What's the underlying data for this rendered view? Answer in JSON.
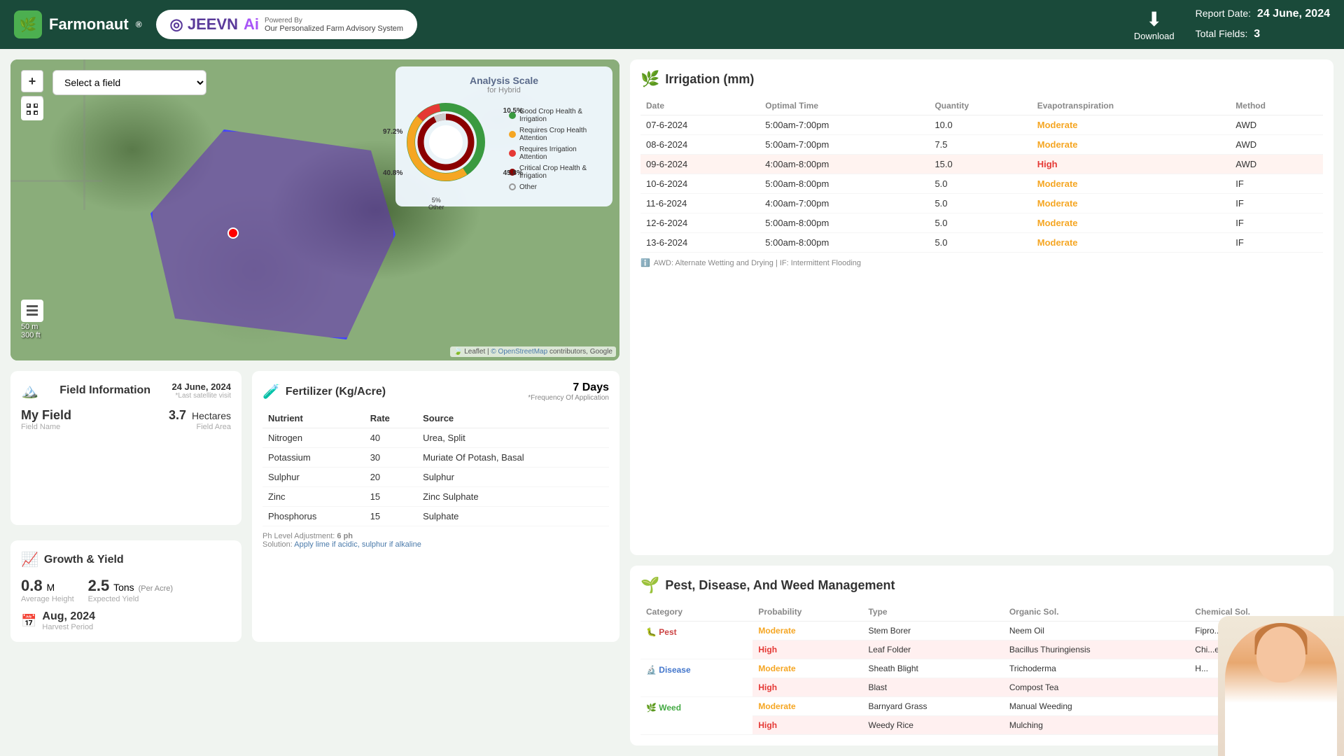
{
  "header": {
    "logo_text": "Farmonaut",
    "logo_reg": "®",
    "jeevn_label": "JEEVN",
    "ai_label": "Ai",
    "powered_by": "Powered By",
    "powered_sub": "Our Personalized Farm Advisory System",
    "report_date_label": "Report Date:",
    "report_date_value": "24 June, 2024",
    "total_fields_label": "Total Fields:",
    "total_fields_value": "3",
    "download_label": "Download"
  },
  "map": {
    "select_placeholder": "Select a field",
    "zoom_in": "+",
    "zoom_out": "−",
    "scale_m": "50 m",
    "scale_ft": "300 ft",
    "attribution": "Leaflet | © OpenStreetMap contributors, Google"
  },
  "analysis_scale": {
    "title": "Analysis Scale",
    "subtitle": "for Hybrid",
    "label_97": "97.2%",
    "label_10": "10.5%",
    "label_45": "45.8%",
    "label_5": "5%\nOther",
    "label_40": "40.8%",
    "legend": [
      {
        "color": "#3a9a40",
        "label": "Good Crop Health & Irrigation"
      },
      {
        "color": "#f5a623",
        "label": "Requires Crop Health Attention"
      },
      {
        "color": "#e53935",
        "label": "Requires Irrigation Attention"
      },
      {
        "color": "#8B0000",
        "label": "Critical Crop Health & Irrigation"
      },
      {
        "color": "none",
        "label": "Other"
      }
    ]
  },
  "field_info": {
    "section_title": "Field Information",
    "date": "24 June, 2024",
    "date_sub": "*Last satellite visit",
    "field_name": "My Field",
    "field_name_label": "Field Name",
    "field_area": "3.7",
    "field_area_unit": "Hectares",
    "field_area_label": "Field Area"
  },
  "growth": {
    "section_title": "Growth & Yield",
    "height_val": "0.8",
    "height_unit": "M",
    "height_label": "Average Height",
    "yield_val": "2.5",
    "yield_unit": "Tons",
    "yield_per": "(Per Acre)",
    "yield_label": "Expected Yield",
    "harvest_val": "Aug, 2024",
    "harvest_label": "Harvest Period"
  },
  "fertilizer": {
    "section_title": "Fertilizer (Kg/Acre)",
    "freq_days": "7 Days",
    "freq_label": "*Frequency Of Application",
    "columns": [
      "Nutrient",
      "Rate",
      "Source"
    ],
    "rows": [
      {
        "nutrient": "Nitrogen",
        "rate": "40",
        "source": "Urea, Split"
      },
      {
        "nutrient": "Potassium",
        "rate": "30",
        "source": "Muriate Of Potash, Basal"
      },
      {
        "nutrient": "Sulphur",
        "rate": "20",
        "source": "Sulphur"
      },
      {
        "nutrient": "Zinc",
        "rate": "15",
        "source": "Zinc Sulphate"
      },
      {
        "nutrient": "Phosphorus",
        "rate": "15",
        "source": "Sulphate"
      }
    ],
    "footnote_ph": "Ph Level Adjustment: 6 ph",
    "footnote_sol": "Solution: Apply lime if acidic, sulphur if alkaline"
  },
  "irrigation": {
    "section_title": "Irrigation (mm)",
    "columns": [
      "Date",
      "Optimal Time",
      "Quantity",
      "Evapotranspiration",
      "Method"
    ],
    "rows": [
      {
        "date": "07-6-2024",
        "time": "5:00am-7:00pm",
        "qty": "10.0",
        "et": "Moderate",
        "method": "AWD",
        "highlight": false
      },
      {
        "date": "08-6-2024",
        "time": "5:00am-7:00pm",
        "qty": "7.5",
        "et": "Moderate",
        "method": "AWD",
        "highlight": false
      },
      {
        "date": "09-6-2024",
        "time": "4:00am-8:00pm",
        "qty": "15.0",
        "et": "High",
        "method": "AWD",
        "highlight": true
      },
      {
        "date": "10-6-2024",
        "time": "5:00am-8:00pm",
        "qty": "5.0",
        "et": "Moderate",
        "method": "IF",
        "highlight": false
      },
      {
        "date": "11-6-2024",
        "time": "4:00am-7:00pm",
        "qty": "5.0",
        "et": "Moderate",
        "method": "IF",
        "highlight": false
      },
      {
        "date": "12-6-2024",
        "time": "5:00am-8:00pm",
        "qty": "5.0",
        "et": "Moderate",
        "method": "IF",
        "highlight": false
      },
      {
        "date": "13-6-2024",
        "time": "5:00am-8:00pm",
        "qty": "5.0",
        "et": "Moderate",
        "method": "IF",
        "highlight": false
      }
    ],
    "footnote": "AWD: Alternate Wetting and Drying | IF: Intermittent Flooding"
  },
  "pest": {
    "section_title": "Pest, Disease, And Weed Management",
    "columns": [
      "Category",
      "Probability",
      "Type",
      "Organic Sol.",
      "Chemical Sol."
    ],
    "categories": [
      {
        "name": "Pest",
        "icon": "🐛",
        "color": "cat-pest",
        "items": [
          {
            "prob": "Moderate",
            "prob_class": "prob-moderate",
            "type": "Stem Borer",
            "organic": "Neem Oil",
            "chemical": "Fipro..."
          },
          {
            "prob": "High",
            "prob_class": "prob-high",
            "type": "Leaf Folder",
            "organic": "Bacillus Thuringiensis",
            "chemical": "Chi...e"
          }
        ]
      },
      {
        "name": "Disease",
        "icon": "🔬",
        "color": "cat-disease",
        "items": [
          {
            "prob": "Moderate",
            "prob_class": "prob-moderate",
            "type": "Sheath Blight",
            "organic": "Trichoderma",
            "chemical": "H..."
          },
          {
            "prob": "High",
            "prob_class": "prob-high",
            "type": "Blast",
            "organic": "Compost Tea",
            "chemical": ""
          }
        ]
      },
      {
        "name": "Weed",
        "icon": "🌿",
        "color": "cat-weed",
        "items": [
          {
            "prob": "Moderate",
            "prob_class": "prob-moderate",
            "type": "Barnyard Grass",
            "organic": "Manual Weeding",
            "chemical": ""
          },
          {
            "prob": "High",
            "prob_class": "prob-high",
            "type": "Weedy Rice",
            "organic": "Mulching",
            "chemical": ""
          }
        ]
      }
    ]
  }
}
